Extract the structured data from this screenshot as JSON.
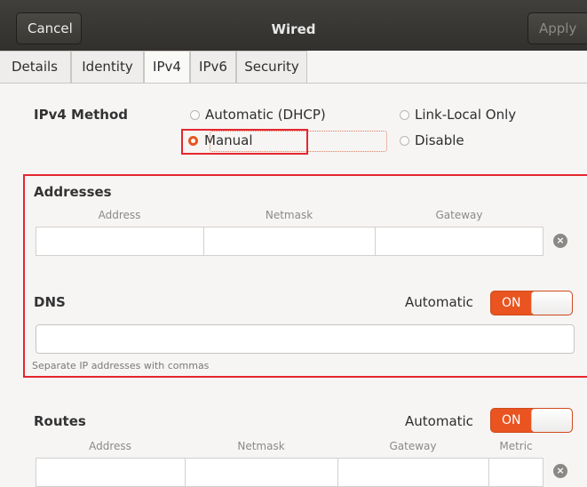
{
  "header": {
    "cancel_label": "Cancel",
    "title": "Wired",
    "apply_label": "Apply"
  },
  "tabs": [
    "Details",
    "Identity",
    "IPv4",
    "IPv6",
    "Security"
  ],
  "active_tab": "IPv4",
  "method": {
    "label": "IPv4 Method",
    "options": [
      "Automatic (DHCP)",
      "Link-Local Only",
      "Manual",
      "Disable"
    ],
    "selected": "Manual"
  },
  "addresses": {
    "title": "Addresses",
    "columns": [
      "Address",
      "Netmask",
      "Gateway"
    ],
    "delete_icon": "circle-x-icon"
  },
  "dns": {
    "title": "DNS",
    "automatic_label": "Automatic",
    "toggle_label": "ON",
    "hint": "Separate IP addresses with commas"
  },
  "routes": {
    "title": "Routes",
    "automatic_label": "Automatic",
    "toggle_label": "ON",
    "columns": [
      "Address",
      "Netmask",
      "Gateway",
      "Metric"
    ]
  },
  "colors": {
    "accent": "#e95420",
    "highlight": "#e5262e",
    "header": "#363531"
  }
}
